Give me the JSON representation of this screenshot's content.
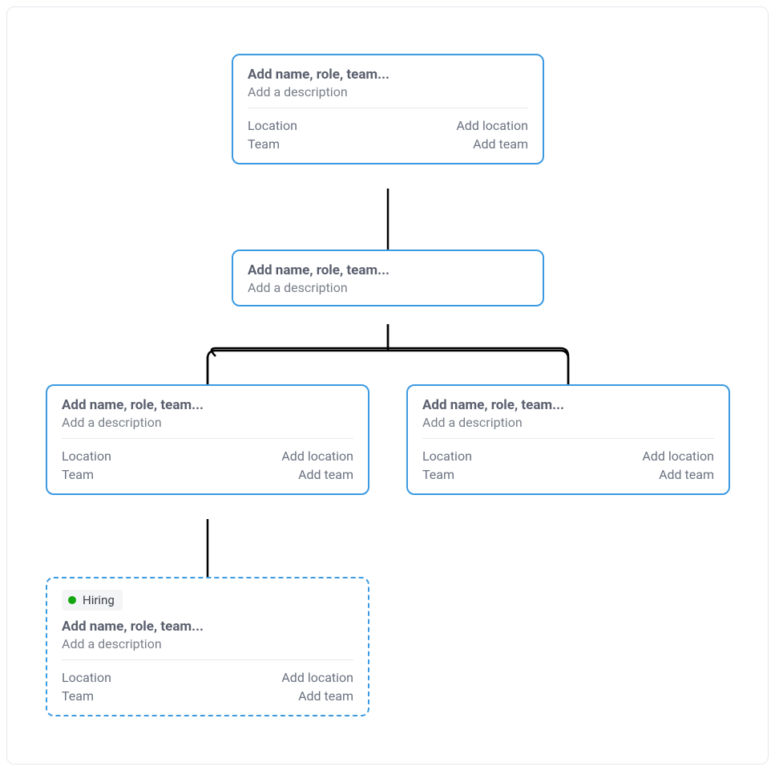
{
  "placeholders": {
    "title": "Add name, role, team...",
    "description": "Add a description",
    "location_label": "Location",
    "location_value": "Add location",
    "team_label": "Team",
    "team_value": "Add team"
  },
  "badge": {
    "label": "Hiring",
    "dot_color": "#12a610"
  },
  "colors": {
    "node_border": "#3b9ae1",
    "connector": "#000000"
  },
  "nodes": {
    "root": {
      "title": "Add name, role, team...",
      "description": "Add a description",
      "location_label": "Location",
      "location_value": "Add location",
      "team_label": "Team",
      "team_value": "Add team"
    },
    "mid": {
      "title": "Add name, role, team...",
      "description": "Add a description"
    },
    "left": {
      "title": "Add name, role, team...",
      "description": "Add a description",
      "location_label": "Location",
      "location_value": "Add location",
      "team_label": "Team",
      "team_value": "Add team"
    },
    "right": {
      "title": "Add name, role, team...",
      "description": "Add a description",
      "location_label": "Location",
      "location_value": "Add location",
      "team_label": "Team",
      "team_value": "Add team"
    },
    "hiring": {
      "badge": "Hiring",
      "title": "Add name, role, team...",
      "description": "Add a description",
      "location_label": "Location",
      "location_value": "Add location",
      "team_label": "Team",
      "team_value": "Add team"
    }
  }
}
